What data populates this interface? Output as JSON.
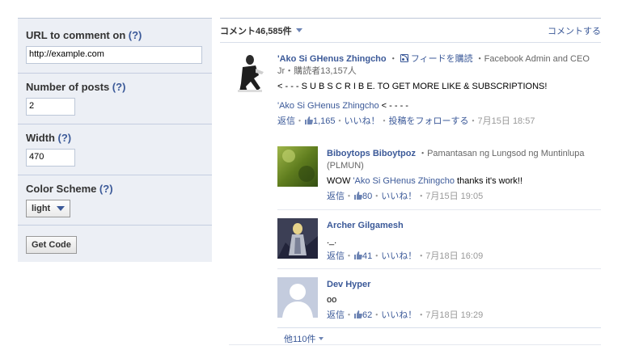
{
  "config": {
    "url_label": "URL to comment on",
    "url_value": "http://example.com",
    "posts_label": "Number of posts",
    "posts_value": "2",
    "width_label": "Width",
    "width_value": "470",
    "scheme_label": "Color Scheme",
    "scheme_value": "light",
    "help_text": "(?)",
    "get_code_label": "Get Code"
  },
  "comments": {
    "count_label": "コメント46,585件",
    "comment_link": "コメントする",
    "more_label": "他110件",
    "main": {
      "author": "'Ako Si GHenus Zhingcho",
      "follow_label": "フィードを購読",
      "title": "Facebook Admin and CEO Jr・購読者13,157人",
      "text": "< - - - S U B S C R I B E. TO GET MORE LIKE & SUBSCRIPTIONS!",
      "mention": "'Ako Si GHenus Zhingcho",
      "text_after_mention": " < - - - -",
      "reply": "返信",
      "likes": "1,165",
      "like_label": "いいね！",
      "follow_post": "投稿をフォローする",
      "date": "7月15日 18:57"
    },
    "replies": [
      {
        "author": "Biboytops Biboytpoz",
        "subtitle": "Pamantasan ng Lungsod ng Muntinlupa (PLMUN)",
        "text_prefix": "WOW ",
        "mention": "'Ako Si GHenus Zhingcho",
        "text_suffix": " thanks it's work!!",
        "reply": "返信",
        "likes": "80",
        "like_label": "いいね！",
        "date": "7月15日 19:05"
      },
      {
        "author": "Archer Gilgamesh",
        "text": "._.",
        "reply": "返信",
        "likes": "41",
        "like_label": "いいね！",
        "date": "7月18日 16:09"
      },
      {
        "author": "Dev Hyper",
        "text": "oo",
        "reply": "返信",
        "likes": "62",
        "like_label": "いいね！",
        "date": "7月18日 19:29"
      }
    ]
  },
  "colors": {
    "link": "#3b5998",
    "panel_bg": "#eceff5",
    "border": "#bdc7d8"
  }
}
